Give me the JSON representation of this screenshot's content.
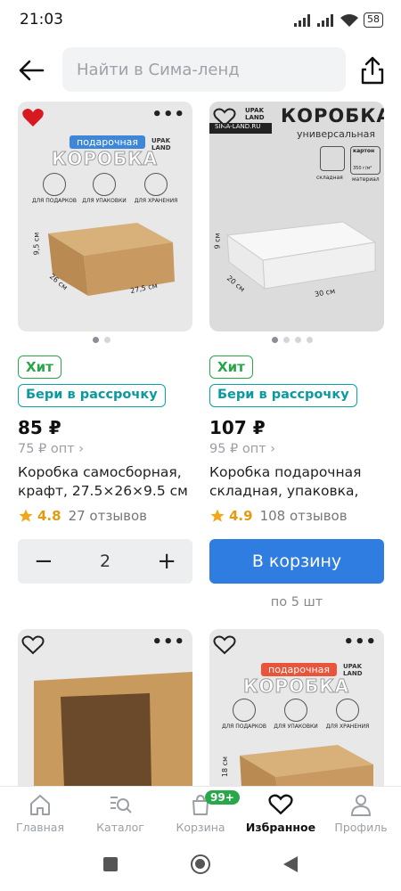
{
  "status": {
    "time": "21:03",
    "battery": "58"
  },
  "search": {
    "placeholder": "Найти в Сима-ленд"
  },
  "products": [
    {
      "image": {
        "tag": "подарочная",
        "headline": "КОРОБКА",
        "brand": "UPAK LAND",
        "features": [
          "ДЛЯ ПОДАРКОВ",
          "ДЛЯ УПАКОВКИ",
          "ДЛЯ ХРАНЕНИЯ"
        ],
        "dims": [
          "9,5 см",
          "26 см",
          "27,5 см"
        ]
      },
      "favorite": true,
      "hit_label": "Хит",
      "installment_label": "Бери в рассрочку",
      "price": "85 ₽",
      "opt_price": "75 ₽ опт ›",
      "title": "Коробка самосборная, крафт, 27.5×26×9.5 см",
      "rating": "4.8",
      "reviews": "27 отзывов",
      "quantity": "2",
      "minus": "−",
      "plus": "+"
    },
    {
      "image": {
        "headline": "КОРОБКА",
        "subheadline": "универсальная",
        "brand": "UPAK LAND",
        "site": "SIMA-LAND.RU",
        "features": [
          "складная",
          "картон",
          "350 г/м²",
          "материал"
        ],
        "dims": [
          "9 см",
          "20 см",
          "30 см"
        ]
      },
      "favorite": false,
      "hit_label": "Хит",
      "installment_label": "Бери в рассрочку",
      "price": "107 ₽",
      "opt_price": "95 ₽ опт ›",
      "title": "Коробка подарочная складная, упаковка,",
      "rating": "4.9",
      "reviews": "108 отзывов",
      "cart_button": "В корзину",
      "min_qty": "по 5 шт"
    },
    {
      "image": {
        "note": "kraft box with window"
      },
      "favorite": false
    },
    {
      "image": {
        "tag": "подарочная",
        "headline": "КОРОБКА",
        "brand": "UPAK LAND",
        "features": [
          "ДЛЯ ПОДАРКОВ",
          "ДЛЯ УПАКОВКИ",
          "ДЛЯ ХРАНЕНИЯ"
        ],
        "dims": [
          "18 см"
        ]
      },
      "favorite": false
    }
  ],
  "nav": {
    "items": [
      {
        "label": "Главная",
        "icon": "home-icon"
      },
      {
        "label": "Каталог",
        "icon": "catalog-search-icon"
      },
      {
        "label": "Корзина",
        "icon": "cart-icon",
        "badge": "99+"
      },
      {
        "label": "Избранное",
        "icon": "heart-icon",
        "active": true
      },
      {
        "label": "Профиль",
        "icon": "profile-icon"
      }
    ]
  },
  "colors": {
    "accent": "#2f7de1",
    "hit": "#2aa64a",
    "installment": "#0aa3a3",
    "favorite": "#d71920",
    "rating": "#f2a61a"
  }
}
